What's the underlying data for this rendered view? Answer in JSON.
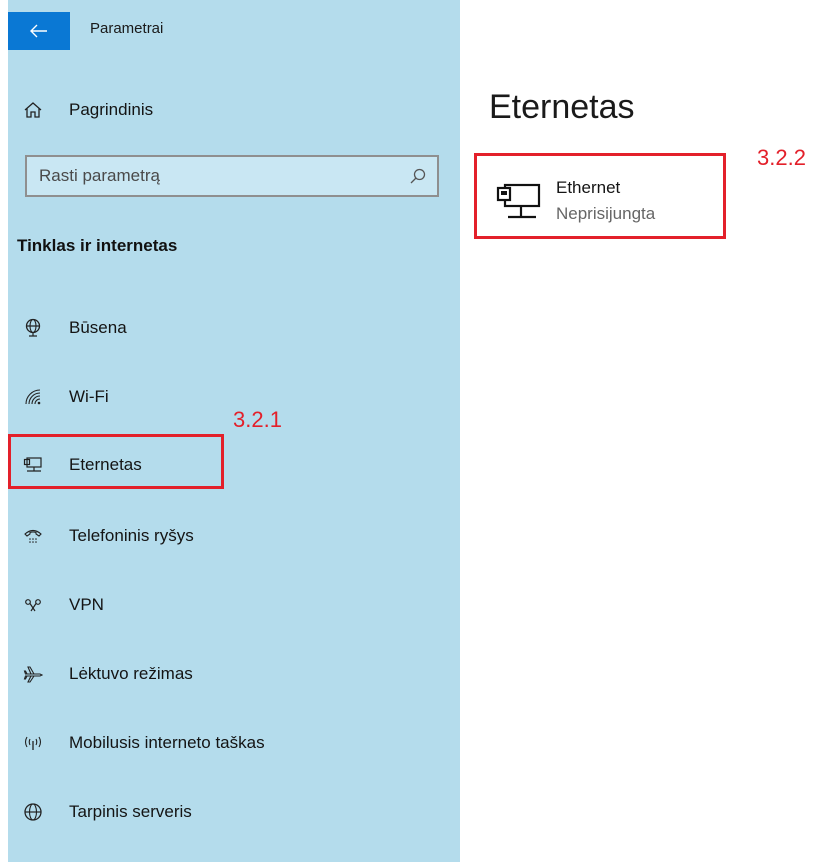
{
  "window": {
    "title": "Parametrai"
  },
  "sidebar": {
    "home_label": "Pagrindinis",
    "search_placeholder": "Rasti parametrą",
    "section_title": "Tinklas ir internetas",
    "items": [
      {
        "label": "Būsena",
        "icon": "globe-status-icon"
      },
      {
        "label": "Wi-Fi",
        "icon": "wifi-icon"
      },
      {
        "label": "Eternetas",
        "icon": "ethernet-icon",
        "selected": true
      },
      {
        "label": "Telefoninis ryšys",
        "icon": "dialup-icon"
      },
      {
        "label": "VPN",
        "icon": "vpn-icon"
      },
      {
        "label": "Lėktuvo režimas",
        "icon": "airplane-icon"
      },
      {
        "label": "Mobilusis interneto taškas",
        "icon": "hotspot-icon"
      },
      {
        "label": "Tarpinis serveris",
        "icon": "globe-icon"
      }
    ]
  },
  "main": {
    "title": "Eternetas",
    "network": {
      "name": "Ethernet",
      "status": "Neprisijungta",
      "icon": "ethernet-icon"
    }
  },
  "annotations": [
    {
      "label": "3.2.1",
      "color": "#e3202a"
    },
    {
      "label": "3.2.2",
      "color": "#e3202a"
    }
  ],
  "colors": {
    "sidebar_bg": "#b4dcec",
    "accent": "#0a78d4",
    "annotation": "#e3202a"
  }
}
